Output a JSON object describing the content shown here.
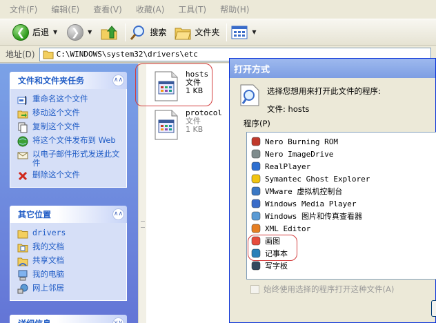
{
  "menu": [
    "文件(F)",
    "编辑(E)",
    "查看(V)",
    "收藏(A)",
    "工具(T)",
    "帮助(H)"
  ],
  "toolbar": {
    "back_label": "后退",
    "search_label": "搜索",
    "folders_label": "文件夹"
  },
  "address": {
    "label": "地址(D)",
    "path": "C:\\WINDOWS\\system32\\drivers\\etc"
  },
  "tasks_panel": {
    "title": "文件和文件夹任务",
    "items": [
      {
        "label": "重命名这个文件",
        "icon": "rename-icon"
      },
      {
        "label": "移动这个文件",
        "icon": "move-icon"
      },
      {
        "label": "复制这个文件",
        "icon": "copy-icon"
      },
      {
        "label": "将这个文件发布到 Web",
        "icon": "web-publish-icon"
      },
      {
        "label": "以电子邮件形式发送此文件",
        "icon": "email-icon"
      },
      {
        "label": "删除这个文件",
        "icon": "delete-icon"
      }
    ]
  },
  "places_panel": {
    "title": "其它位置",
    "items": [
      {
        "label": "drivers",
        "icon": "folder-icon"
      },
      {
        "label": "我的文档",
        "icon": "my-documents-icon"
      },
      {
        "label": "共享文档",
        "icon": "shared-documents-icon"
      },
      {
        "label": "我的电脑",
        "icon": "my-computer-icon"
      },
      {
        "label": "网上邻居",
        "icon": "network-icon"
      }
    ]
  },
  "details_panel": {
    "title": "详细信息"
  },
  "files": [
    {
      "name": "hosts",
      "type": "文件",
      "size": "1 KB"
    },
    {
      "name": "protocol",
      "type": "文件",
      "size": "1 KB"
    }
  ],
  "dialog": {
    "title": "打开方式",
    "prompt": "选择您想用来打开此文件的程序:",
    "file_label": "文件: hosts",
    "programs_label": "程序(P)",
    "programs": [
      {
        "name": "Nero Burning ROM",
        "color": "#c0392b"
      },
      {
        "name": "Nero ImageDrive",
        "color": "#7f8c8d"
      },
      {
        "name": "RealPlayer",
        "color": "#2e6fd1"
      },
      {
        "name": "Symantec Ghost Explorer",
        "color": "#f1c40f"
      },
      {
        "name": "VMware 虚拟机控制台",
        "color": "#3b78c4"
      },
      {
        "name": "Windows Media Player",
        "color": "#3a6cc9"
      },
      {
        "name": "Windows 图片和传真查看器",
        "color": "#5b9bd5"
      },
      {
        "name": "XML Editor",
        "color": "#e67e22"
      },
      {
        "name": "画图",
        "color": "#e74c3c"
      },
      {
        "name": "记事本",
        "color": "#2980b9"
      },
      {
        "name": "写字板",
        "color": "#34495e"
      }
    ],
    "always_use_label": "始终使用选择的程序打开这种文件(A)"
  },
  "colors": {
    "link": "#215dc6",
    "highlight": "#d23c3c",
    "task_pane": "#6375d6"
  }
}
